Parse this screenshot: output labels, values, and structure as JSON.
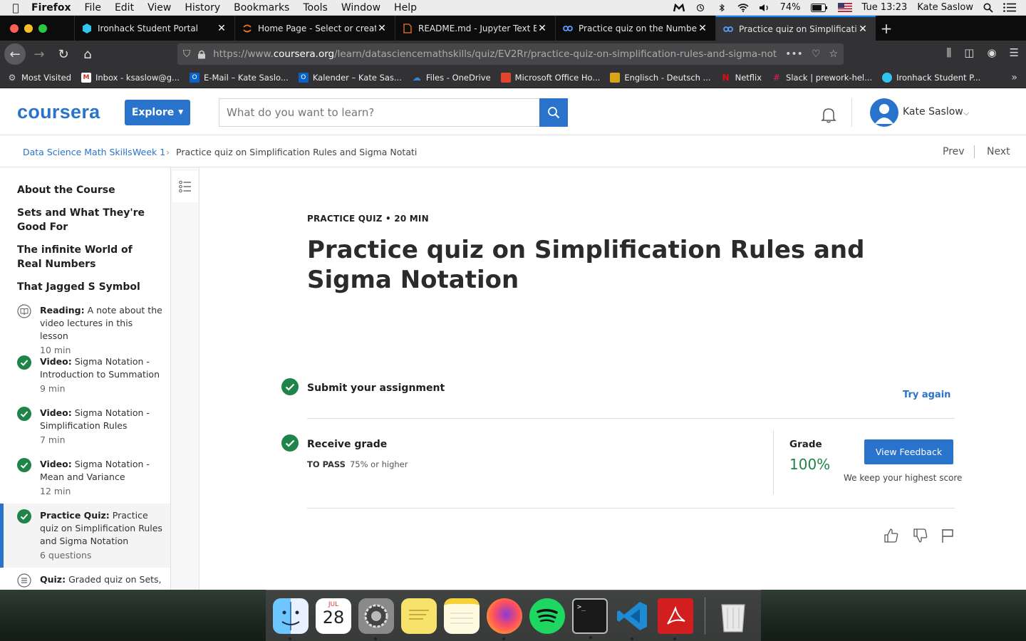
{
  "menubar": {
    "app": "Firefox",
    "items": [
      "File",
      "Edit",
      "View",
      "History",
      "Bookmarks",
      "Tools",
      "Window",
      "Help"
    ],
    "battery": "74%",
    "clock": "Tue 13:23",
    "user": "Kate Saslow"
  },
  "tabs": [
    {
      "label": "Ironhack Student Portal",
      "active": false
    },
    {
      "label": "Home Page - Select or create a",
      "active": false
    },
    {
      "label": "README.md - Jupyter Text Edit",
      "active": false
    },
    {
      "label": "Practice quiz on the Number Li",
      "active": false
    },
    {
      "label": "Practice quiz on Simplification R",
      "active": true
    }
  ],
  "urlbar": {
    "prefix": "https://www.",
    "host": "coursera.org",
    "path": "/learn/datasciencemathskills/quiz/EV2Rr/practice-quiz-on-simplification-rules-and-sigma-notation"
  },
  "bookmarks": [
    {
      "label": "Most Visited",
      "color": "#888888"
    },
    {
      "label": "Inbox - ksaslow@g...",
      "color": "#d93025"
    },
    {
      "label": "E-Mail – Kate Saslo...",
      "color": "#0a64c8"
    },
    {
      "label": "Kalender – Kate Sas...",
      "color": "#0a64c8"
    },
    {
      "label": "Files - OneDrive",
      "color": "#2f86dd"
    },
    {
      "label": "Microsoft Office Ho...",
      "color": "#e2452c"
    },
    {
      "label": "Englisch - Deutsch ...",
      "color": "#d8a21a"
    },
    {
      "label": "Netflix",
      "color": "#e50914"
    },
    {
      "label": "Slack | prework-hel...",
      "color": "#4a154b"
    },
    {
      "label": "Ironhack Student P...",
      "color": "#32c5f0"
    }
  ],
  "header": {
    "logo": "coursera",
    "explore": "Explore",
    "search_placeholder": "What do you want to learn?",
    "user_name": "Kate Saslow"
  },
  "breadcrumb": {
    "course": "Data Science Math Skills",
    "week": "Week 1",
    "current": "Practice quiz on Simplification Rules and Sigma Notati",
    "prev": "Prev",
    "next": "Next"
  },
  "sidebar": {
    "sections": [
      "About the Course",
      "Sets and What They're Good For",
      "The infinite World of Real Numbers",
      "That Jagged S Symbol"
    ],
    "items": [
      {
        "type": "Reading:",
        "title": "A note about the video lectures in this lesson",
        "duration": "10 min",
        "icon": "book-icon",
        "done": false
      },
      {
        "type": "Video:",
        "title": "Sigma Notation - Introduction to Summation",
        "duration": "9 min",
        "icon": "check-circle-icon",
        "done": true
      },
      {
        "type": "Video:",
        "title": "Sigma Notation - Simplification Rules",
        "duration": "7 min",
        "icon": "check-circle-icon",
        "done": true
      },
      {
        "type": "Video:",
        "title": "Sigma Notation - Mean and Variance",
        "duration": "12 min",
        "icon": "check-circle-icon",
        "done": true
      },
      {
        "type": "Practice Quiz:",
        "title": "Practice quiz on Simplification Rules and Sigma Notation",
        "duration": "6 questions",
        "icon": "check-circle-icon",
        "done": true,
        "active": true
      },
      {
        "type": "Quiz:",
        "title": "Graded quiz on Sets,",
        "duration": "",
        "icon": "quiz-icon",
        "done": false
      }
    ]
  },
  "main": {
    "meta": "PRACTICE QUIZ • 20 MIN",
    "title": "Practice quiz on Simplification Rules and Sigma Notation",
    "submit_label": "Submit your assignment",
    "try_again": "Try again",
    "receive_label": "Receive grade",
    "to_pass_label": "TO PASS",
    "to_pass_value": "75% or higher",
    "grade_label": "Grade",
    "grade_value": "100%",
    "view_feedback": "View Feedback",
    "highest_note": "We keep your highest score"
  },
  "colors": {
    "brand": "#2a73cc",
    "success": "#1e8449"
  },
  "dock": {
    "calendar_month": "JUL",
    "calendar_day": "28"
  }
}
